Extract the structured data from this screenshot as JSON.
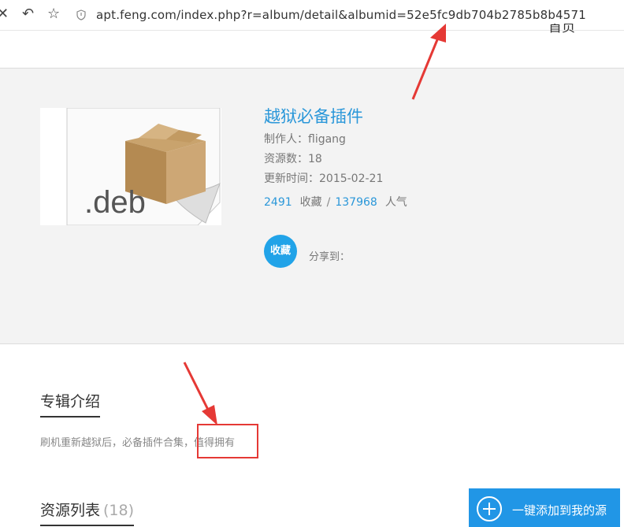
{
  "browser": {
    "url": "apt.feng.com/index.php?r=album/detail&albumid=52e5fc9db704b2785b8b4571",
    "close_glyph": "✕",
    "back_glyph": "↶",
    "star_glyph": "☆"
  },
  "nav": {
    "home_label": "首页"
  },
  "album": {
    "cover_text": ".deb",
    "title": "越狱必备插件",
    "author": "制作人：fligang",
    "resource_count": "资源数：18",
    "updated": "更新时间：2015-02-21",
    "favorites_count": "2491",
    "favorites_label": "收藏",
    "separator": "/",
    "popularity_count": "137968",
    "popularity_label": "人气",
    "favorite_button": "收藏",
    "share_label": "分享到："
  },
  "intro": {
    "heading": "专辑介绍",
    "text_prefix": "刷机重新越狱后，必备插件合集，",
    "text_highlight": "值得拥有"
  },
  "resources": {
    "heading": "资源列表",
    "count": "(18)"
  },
  "add_button": {
    "label": "一键添加到我的源"
  },
  "colors": {
    "accent": "#2a97d9",
    "annotation": "#e53935",
    "button": "#2196e6"
  }
}
